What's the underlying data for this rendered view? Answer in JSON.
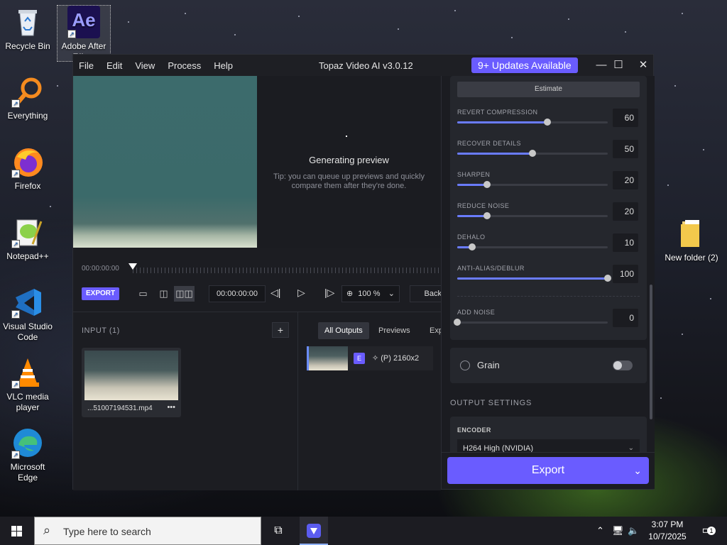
{
  "desktop": {
    "icons": [
      {
        "label": "Recycle Bin"
      },
      {
        "label": "Adobe After Effe...",
        "badge": "Ae"
      },
      {
        "label": "Everything"
      },
      {
        "label": "Firefox"
      },
      {
        "label": "Notepad++"
      },
      {
        "label": "Visual Studio Code"
      },
      {
        "label": "VLC media player"
      },
      {
        "label": "Microsoft Edge"
      },
      {
        "label": "New folder (2)"
      }
    ]
  },
  "window": {
    "menu": [
      "File",
      "Edit",
      "View",
      "Process",
      "Help"
    ],
    "title": "Topaz Video AI  v3.0.12",
    "updates": "9+ Updates Available",
    "controls": {
      "minimize": "—",
      "maximize": "☐",
      "close": "✕"
    }
  },
  "preview": {
    "generating_title": "Generating preview",
    "generating_tip": "Tip: you can queue up previews and quickly compare them after they're done."
  },
  "timeline": {
    "start_time": "00:00:00:00",
    "export_label": "EXPORT",
    "time_value": "00:00:00:00",
    "zoom": "100 %",
    "back_label": "Back"
  },
  "input": {
    "title": "INPUT (1)",
    "add": "+",
    "file_name": "...51007194531.mp4",
    "more": "•••"
  },
  "outputs": {
    "tabs": [
      "All Outputs",
      "Previews",
      "Export"
    ],
    "active_tab": "All Outputs",
    "row": {
      "badge": "E",
      "text": "✧ (P)  2160x2"
    }
  },
  "settings": {
    "estimate": "Estimate",
    "sliders": [
      {
        "label": "REVERT COMPRESSION",
        "value": "60",
        "level": 0.6
      },
      {
        "label": "RECOVER DETAILS",
        "value": "50",
        "level": 0.5
      },
      {
        "label": "SHARPEN",
        "value": "20",
        "level": 0.2
      },
      {
        "label": "REDUCE NOISE",
        "value": "20",
        "level": 0.2
      },
      {
        "label": "DEHALO",
        "value": "10",
        "level": 0.1
      },
      {
        "label": "ANTI-ALIAS/DEBLUR",
        "value": "100",
        "level": 1.0
      },
      {
        "label": "ADD NOISE",
        "value": "0",
        "level": 0.0
      }
    ],
    "grain_label": "Grain",
    "output_settings_title": "OUTPUT SETTINGS",
    "encoder_label": "ENCODER",
    "encoder_value": "H264 High (NVIDIA)",
    "export_button": "Export"
  },
  "taskbar": {
    "search_placeholder": "Type here to search",
    "time": "3:07 PM",
    "date": "10/7/2025",
    "notification_count": "1"
  },
  "colors": {
    "accent": "#6a5cff",
    "slider_fill": "#6a7cff"
  }
}
